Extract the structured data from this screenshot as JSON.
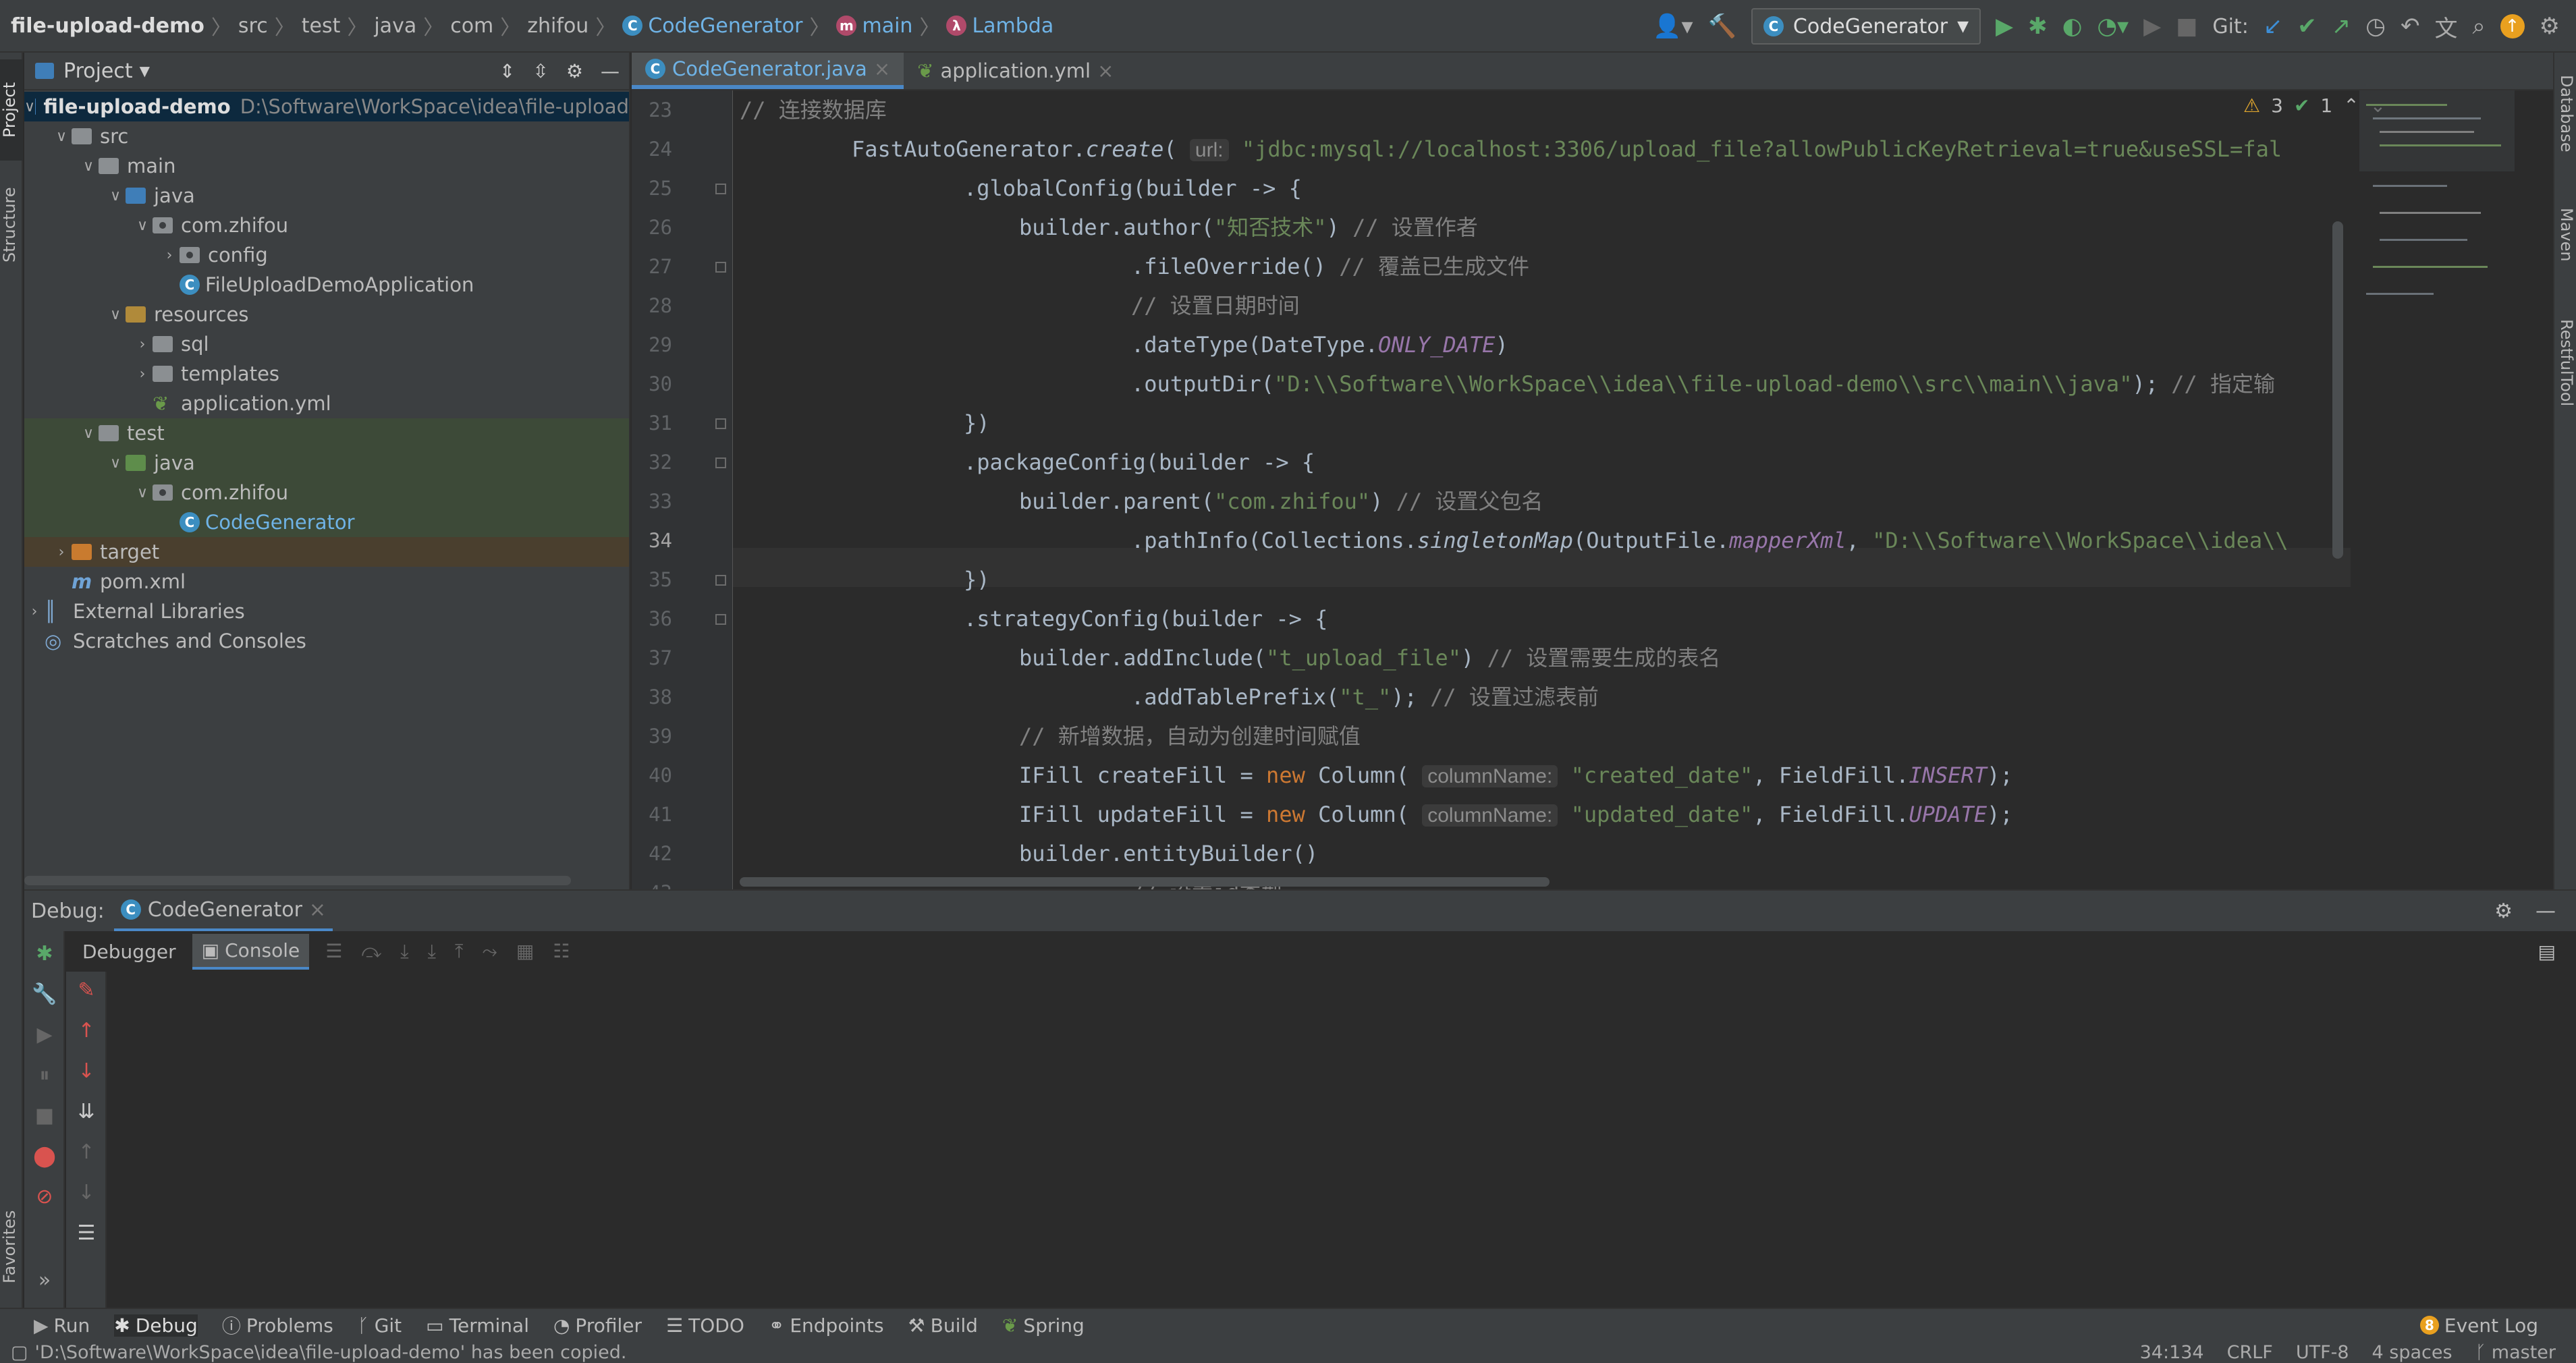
{
  "navbar": {
    "crumbs": [
      "file-upload-demo",
      "src",
      "test",
      "java",
      "com",
      "zhifou",
      "CodeGenerator",
      "main",
      "Lambda"
    ],
    "run_config": "CodeGenerator",
    "git_label": "Git:"
  },
  "left_strip": {
    "project": "Project",
    "structure": "Structure",
    "favorites": "Favorites"
  },
  "right_strip": {
    "database": "Database",
    "maven": "Maven",
    "restful": "RestfulTool"
  },
  "project": {
    "header": "Project",
    "root_name": "file-upload-demo",
    "root_path": "D:\\Software\\WorkSpace\\idea\\file-upload",
    "items": [
      {
        "label": "src",
        "depth": 1,
        "arrow": "v",
        "icon": "gray"
      },
      {
        "label": "main",
        "depth": 2,
        "arrow": "v",
        "icon": "gray"
      },
      {
        "label": "java",
        "depth": 3,
        "arrow": "v",
        "icon": "blue"
      },
      {
        "label": "com.zhifou",
        "depth": 4,
        "arrow": "v",
        "icon": "pkg"
      },
      {
        "label": "config",
        "depth": 5,
        "arrow": ">",
        "icon": "pkg"
      },
      {
        "label": "FileUploadDemoApplication",
        "depth": 5,
        "arrow": "",
        "icon": "class"
      },
      {
        "label": "resources",
        "depth": 3,
        "arrow": "v",
        "icon": "yellow"
      },
      {
        "label": "sql",
        "depth": 4,
        "arrow": ">",
        "icon": "gray"
      },
      {
        "label": "templates",
        "depth": 4,
        "arrow": ">",
        "icon": "gray"
      },
      {
        "label": "application.yml",
        "depth": 4,
        "arrow": "",
        "icon": "yml"
      },
      {
        "label": "test",
        "depth": 2,
        "arrow": "v",
        "icon": "gray"
      },
      {
        "label": "java",
        "depth": 3,
        "arrow": "v",
        "icon": "green"
      },
      {
        "label": "com.zhifou",
        "depth": 4,
        "arrow": "v",
        "icon": "pkg"
      },
      {
        "label": "CodeGenerator",
        "depth": 5,
        "arrow": "",
        "icon": "class"
      },
      {
        "label": "target",
        "depth": 1,
        "arrow": ">",
        "icon": "orange"
      },
      {
        "label": "pom.xml",
        "depth": 1,
        "arrow": "",
        "icon": "pom"
      },
      {
        "label": "External Libraries",
        "depth": 0,
        "arrow": ">",
        "icon": "lib"
      },
      {
        "label": "Scratches and Consoles",
        "depth": 0,
        "arrow": "",
        "icon": "scratch"
      }
    ]
  },
  "editor": {
    "tabs": [
      {
        "label": "CodeGenerator.java",
        "active": true
      },
      {
        "label": "application.yml",
        "active": false
      }
    ],
    "inspection": {
      "warnings": "3",
      "checks": "1"
    },
    "line_numbers": [
      "23",
      "24",
      "25",
      "26",
      "27",
      "28",
      "29",
      "30",
      "31",
      "32",
      "33",
      "34",
      "35",
      "36",
      "37",
      "38",
      "39",
      "40",
      "41",
      "42",
      "43"
    ],
    "lines": {
      "l23": "// 连接数据库",
      "l24a": "FastAutoGenerator.",
      "l24b": "create",
      "l24c": "( ",
      "l24hint": "url:",
      "l24str": " \"jdbc:mysql://localhost:3306/upload_file?allowPublicKeyRetrieval=true&useSSL=fal",
      "l25": ".globalConfig(builder -> {",
      "l26a": "builder.author(",
      "l26str": "\"知否技术\"",
      "l26b": ") ",
      "l26cm": "// 设置作者",
      "l27a": ".fileOverride() ",
      "l27cm": "// 覆盖已生成文件",
      "l28cm": "// 设置日期时间",
      "l29a": ".dateType(DateType.",
      "l29const": "ONLY_DATE",
      "l29b": ")",
      "l30a": ".outputDir(",
      "l30str": "\"D:\\\\Software\\\\WorkSpace\\\\idea\\\\file-upload-demo\\\\src\\\\main\\\\java\"",
      "l30b": "); ",
      "l30cm": "// 指定输",
      "l31": "})",
      "l32": ".packageConfig(builder -> {",
      "l33a": "builder.parent(",
      "l33str": "\"com.zhifou\"",
      "l33b": ") ",
      "l33cm": "// 设置父包名",
      "l34a": ".pathInfo(Collections.",
      "l34b": "singletonMap",
      "l34c": "(OutputFile.",
      "l34const": "mapperXml",
      "l34d": ", ",
      "l34str": "\"D:\\\\Software\\\\WorkSpace\\\\idea\\\\",
      "l35": "})",
      "l36": ".strategyConfig(builder -> {",
      "l37a": "builder.addInclude(",
      "l37str": "\"t_upload_file\"",
      "l37b": ") ",
      "l37cm": "// 设置需要生成的表名",
      "l38a": ".addTablePrefix(",
      "l38str": "\"t_\"",
      "l38b": "); ",
      "l38cm": "// 设置过滤表前",
      "l39cm": "// 新增数据，自动为创建时间赋值",
      "l40a": "IFill createFill = ",
      "l40kw": "new",
      "l40b": " Column( ",
      "l40hint": "columnName:",
      "l40str": " \"created_date\"",
      "l40c": ", FieldFill.",
      "l40const": "INSERT",
      "l40d": ");",
      "l41a": "IFill updateFill = ",
      "l41kw": "new",
      "l41b": " Column( ",
      "l41hint": "columnName:",
      "l41str": " \"updated_date\"",
      "l41c": ", FieldFill.",
      "l41const": "UPDATE",
      "l41d": ");",
      "l42": "builder.entityBuilder()",
      "l43cm": "// 设置id类型"
    }
  },
  "debug": {
    "title": "Debug:",
    "session_tab": "CodeGenerator",
    "tabs": [
      "Debugger",
      "Console"
    ]
  },
  "bottom_tools": [
    "Run",
    "Debug",
    "Problems",
    "Git",
    "Terminal",
    "Profiler",
    "TODO",
    "Endpoints",
    "Build",
    "Spring"
  ],
  "event_log": "Event Log",
  "status": {
    "message": "'D:\\Software\\WorkSpace\\idea\\file-upload-demo' has been copied.",
    "position": "34:134",
    "line_sep": "CRLF",
    "encoding": "UTF-8",
    "indent": "4 spaces",
    "branch": "master"
  },
  "colors": {
    "accent": "#4a88c7",
    "string": "#6a8759",
    "keyword": "#cc7832",
    "comment": "#808080"
  }
}
